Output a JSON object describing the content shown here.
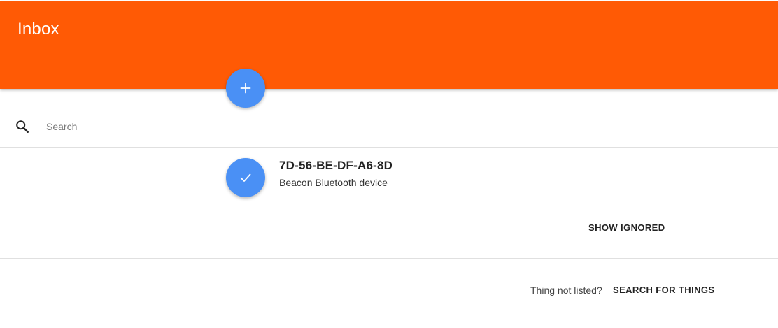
{
  "header": {
    "title": "Inbox",
    "color": "#ff5a05"
  },
  "add_button": {
    "icon": "plus-icon",
    "color": "#4a90f5"
  },
  "search": {
    "icon": "search-icon",
    "placeholder": "Search",
    "value": ""
  },
  "things": [
    {
      "name": "7D-56-BE-DF-A6-8D",
      "description": "Beacon Bluetooth device",
      "icon": "checkmark-icon"
    }
  ],
  "actions": {
    "show_ignored_label": "SHOW IGNORED",
    "not_listed_text": "Thing not listed?",
    "search_things_label": "SEARCH FOR THINGS"
  }
}
